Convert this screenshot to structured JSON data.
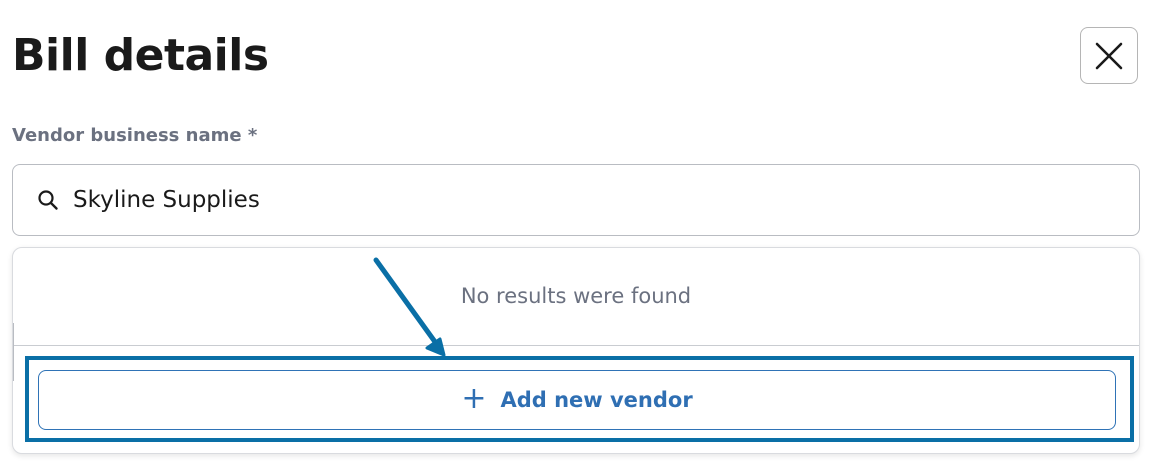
{
  "page": {
    "title": "Bill details",
    "close_icon": "close-icon"
  },
  "vendor_field": {
    "label": "Vendor business name *",
    "search_icon": "search-icon",
    "value": "Skyline Supplies"
  },
  "dropdown": {
    "empty_message": "No results were found",
    "add_button": {
      "icon": "plus-icon",
      "label": "Add new vendor"
    }
  },
  "annotation": {
    "color": "#0a6fa6"
  },
  "colors": {
    "accent": "#2f6fb3",
    "label_gray": "#6b7180",
    "title": "#1a1a1a"
  }
}
